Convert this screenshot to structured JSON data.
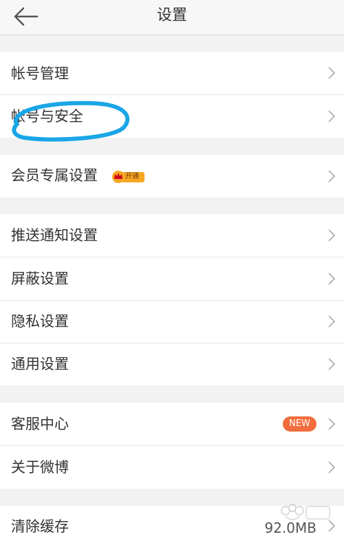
{
  "header": {
    "title": "设置"
  },
  "groups": [
    {
      "items": [
        {
          "label": "帐号管理"
        },
        {
          "label": "帐号与安全"
        }
      ]
    },
    {
      "items": [
        {
          "label": "会员专属设置",
          "badge": "开通"
        }
      ]
    },
    {
      "items": [
        {
          "label": "推送通知设置"
        },
        {
          "label": "屏蔽设置"
        },
        {
          "label": "隐私设置"
        },
        {
          "label": "通用设置"
        }
      ]
    },
    {
      "items": [
        {
          "label": "客服中心",
          "badge": "NEW"
        },
        {
          "label": "关于微博"
        }
      ]
    },
    {
      "items": [
        {
          "label": "清除缓存",
          "value": "92.0MB"
        }
      ]
    }
  ],
  "colors": {
    "background": "#f2f2f2",
    "row": "#ffffff",
    "new_badge": "#f26d3d",
    "crown_badge": "#f5a623",
    "annotation": "#1aa6e6"
  },
  "icons": [
    "back-arrow-icon",
    "chevron-right-icon",
    "crown-icon"
  ]
}
